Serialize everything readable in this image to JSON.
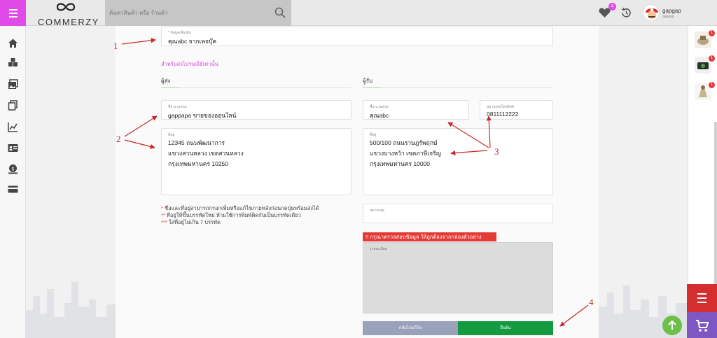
{
  "header": {
    "logo_text": "COMMERZY",
    "search_placeholder": "ค้นหาสินค้า หรือ ร้านค้า",
    "wishlist_count": "4",
    "username": "gapgap",
    "user_sub": "gapgap",
    "accent": "#e04ae6"
  },
  "sidebar": {
    "items": [
      {
        "icon": "home-icon"
      },
      {
        "icon": "boxes-icon"
      },
      {
        "icon": "gallery-icon"
      },
      {
        "icon": "copy-icon"
      },
      {
        "icon": "chart-icon"
      },
      {
        "icon": "id-card-icon"
      },
      {
        "icon": "coin-icon"
      },
      {
        "icon": "card-icon"
      }
    ]
  },
  "right_panel": {
    "thumb_badges": [
      "1",
      "1",
      "1"
    ]
  },
  "form": {
    "extra_info": {
      "label": "* ข้อมูลเพิ่มเติม",
      "value": "คุณabc จากเพจบุ๊ค"
    },
    "section_note": "สำหรับส่งไปรษณีย์เท่านั้น",
    "sender": {
      "heading": "ผู้ส่ง",
      "name_label": "ชื่อ-นามสกุล",
      "name_value": "gappapa ขายของออนไลน์",
      "address_label": "ที่อยู่",
      "address_lines": [
        "12345 ถนนพัฒนาการ",
        "แขวงสวนหลวง เขตสวนหลวง",
        "กรุงเทพมหานคร 10250"
      ]
    },
    "receiver": {
      "heading": "ผู้รับ",
      "name_label": "ชื่อ-นามสกุล",
      "name_value": "คุณabc",
      "phone_label": "หมายเลขโทรศัพท์",
      "phone_value": "0811112222",
      "address_label": "ที่อยู่",
      "address_lines": [
        "500/100 ถนนราษฎร์พฤกษ์",
        "แขวงบางหว้า เขตภาษีเจริญ",
        "กรุงเทพมหานคร 10000"
      ],
      "note_label": "หมายเหตุ"
    },
    "notes": [
      {
        "mark": "*",
        "text": " ชื่อและที่อยู่สามารถกรอกเพิ่มหรือแก้ไขภายหลังก่อนกดปุ่มพร้อมส่งได้"
      },
      {
        "mark": "**",
        "text": " ที่อยู่ให้ขึ้นบรรทัดใหม่ ห้ามใช้การพิมพ์ติดกันเป็นบรรทัดเดียว"
      },
      {
        "mark": "***",
        "text": " ใส่ที่อยู่ไม่เกิน 7 บรรทัด"
      }
    ],
    "warning": "!! กรุณาตรวจสอบข้อมูล ให้ถูกต้องจากกล่องตัวอย่าง",
    "preview_label": "รายละเอียด",
    "back_button": "กลับไปแก้ไข",
    "confirm_button": "ยืนยัน"
  },
  "annotations": [
    "1",
    "2",
    "3",
    "4"
  ]
}
